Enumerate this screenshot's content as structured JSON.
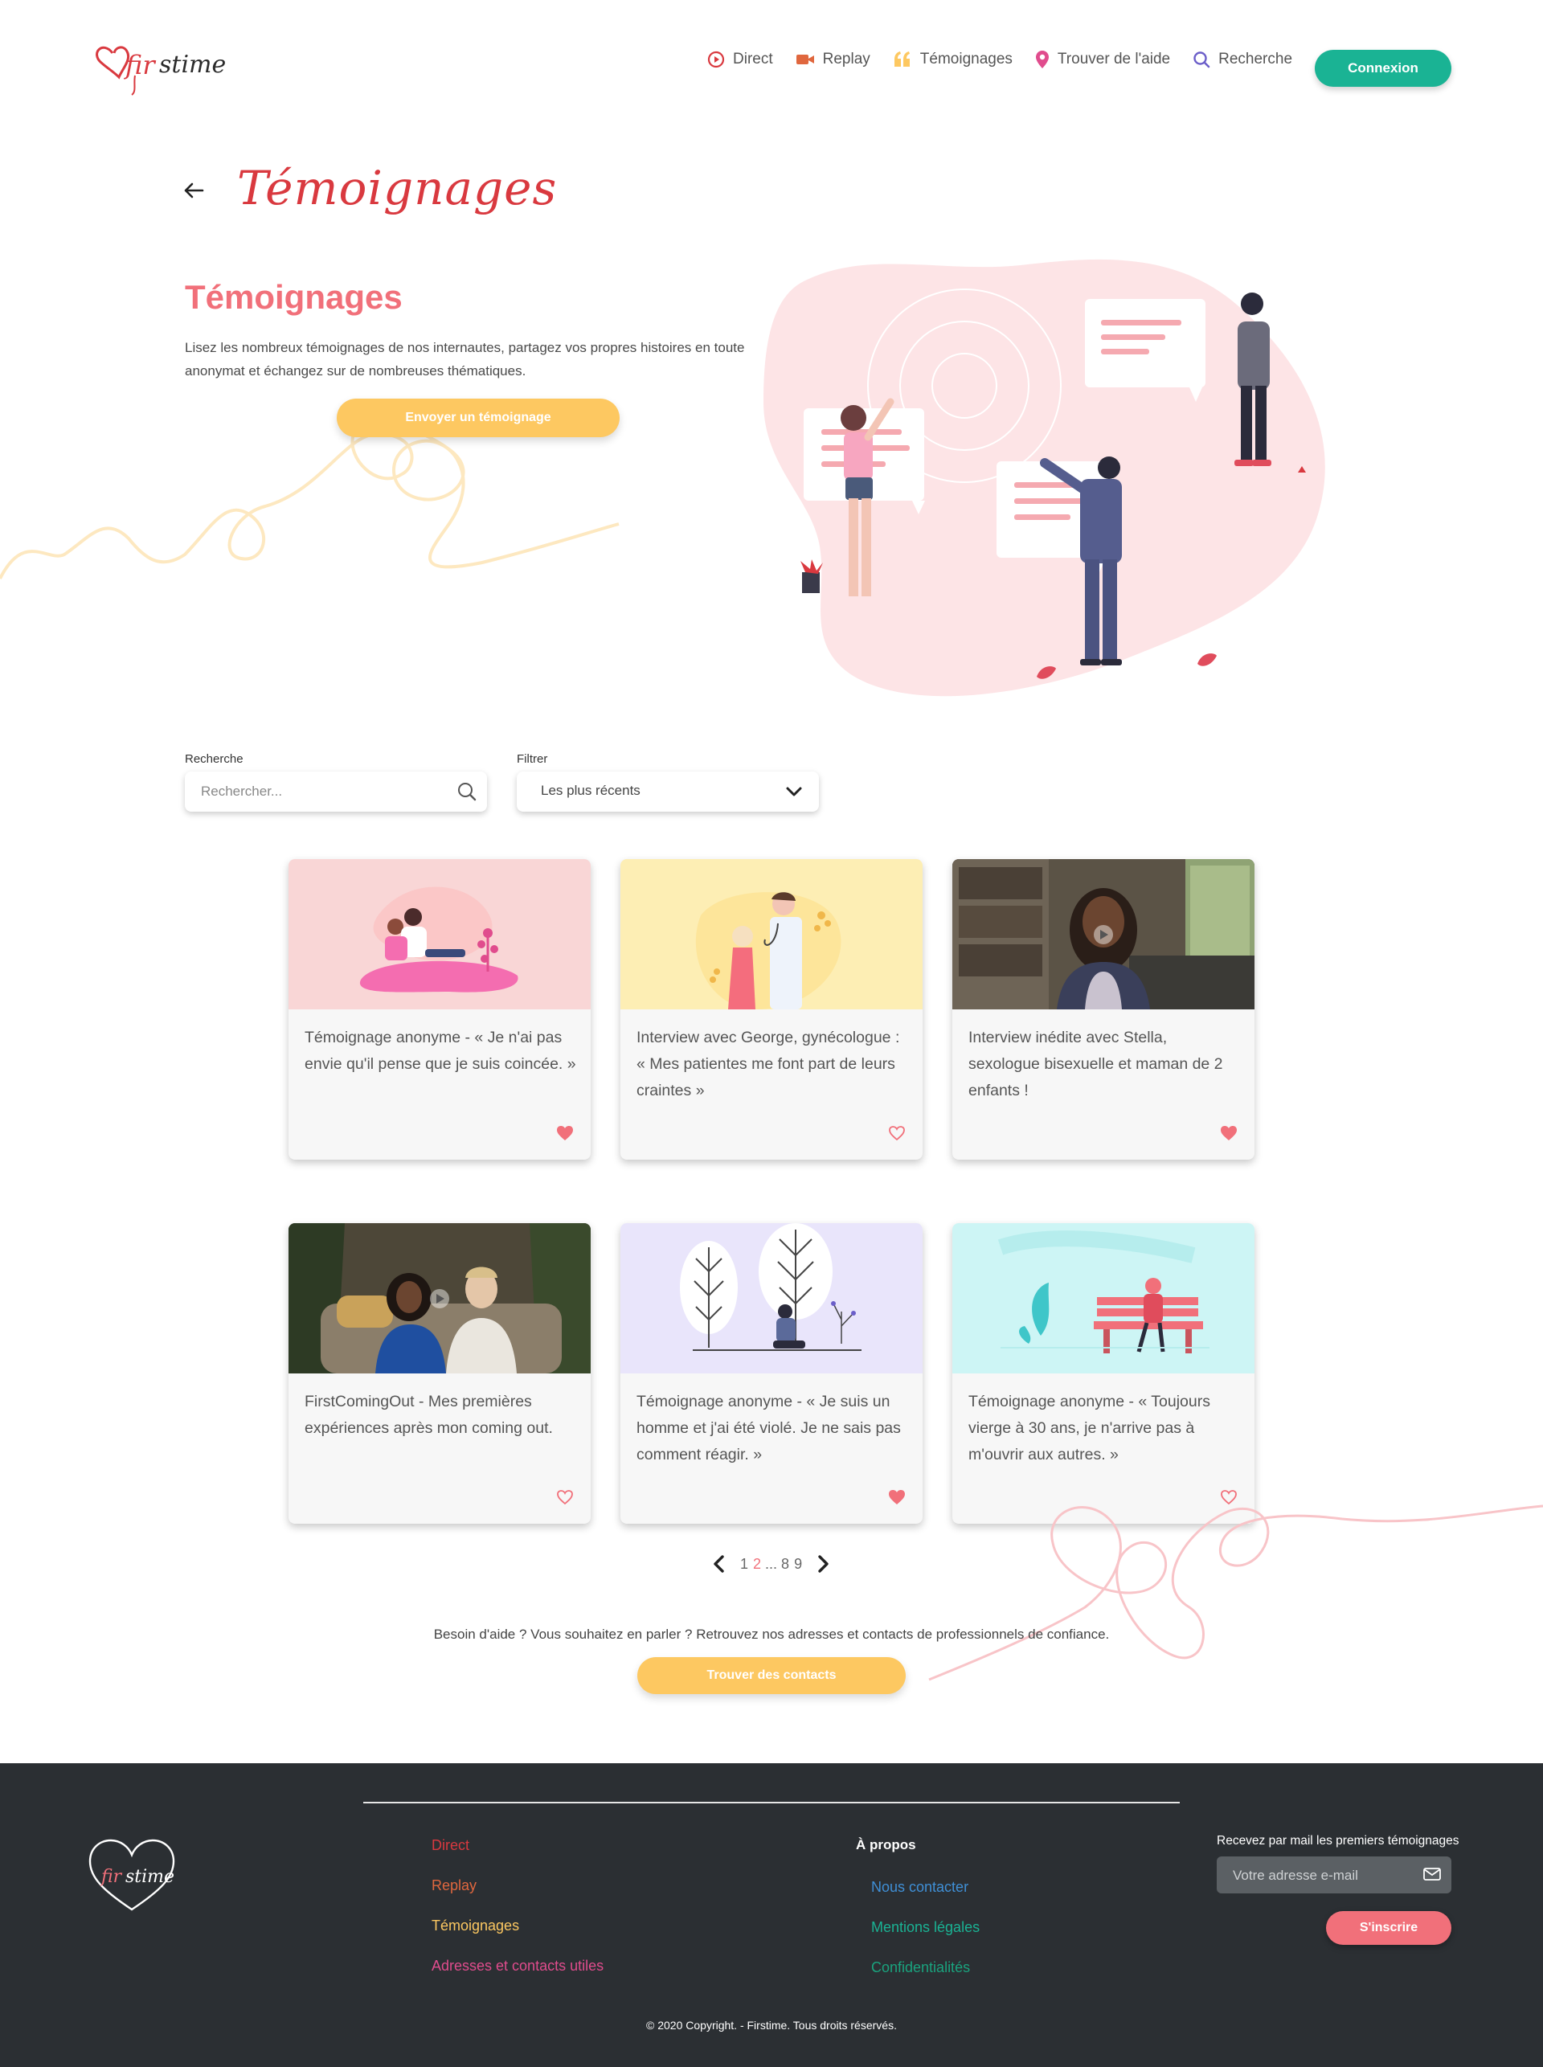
{
  "header": {
    "nav": [
      {
        "label": "Direct",
        "icon": "play-circle-icon",
        "color": "#d9393f"
      },
      {
        "label": "Replay",
        "icon": "video-camera-icon",
        "color": "#e0673e"
      },
      {
        "label": "Témoignages",
        "icon": "quote-icon",
        "color": "#fdc861"
      },
      {
        "label": "Trouver de l'aide",
        "icon": "map-pin-icon",
        "color": "#e04c8d"
      },
      {
        "label": "Recherche",
        "icon": "search-icon",
        "color": "#6b5ec9"
      }
    ],
    "login_label": "Connexion"
  },
  "page_title": "Témoignages",
  "hero": {
    "title": "Témoignages",
    "description": "Lisez les nombreux témoignages de nos internautes, partagez vos propres histoires en toute anonymat et échangez sur de nombreuses thématiques.",
    "button_label": "Envoyer un témoignage"
  },
  "filters": {
    "search_label": "Recherche",
    "search_placeholder": "Rechercher...",
    "filter_label": "Filtrer",
    "filter_value": "Les plus récents"
  },
  "cards": [
    {
      "text": "Témoignage anonyme - « Je n'ai pas envie qu'il pense que je suis coincée. »",
      "liked": true,
      "thumb": "illustration-couple-pink"
    },
    {
      "text": "Interview avec George, gynécologue : « Mes patientes me font part de leurs craintes »",
      "liked": false,
      "thumb": "illustration-doctor-yellow"
    },
    {
      "text": "Interview inédite avec Stella, sexologue bisexuelle et maman de 2 enfants !",
      "liked": true,
      "thumb": "video-stella"
    },
    {
      "text": "FirstComingOut - Mes premières expériences après mon coming out.",
      "liked": false,
      "thumb": "video-comingout"
    },
    {
      "text": "Témoignage anonyme - « Je suis un homme et j'ai été violé. Je ne sais pas comment réagir. »",
      "liked": true,
      "thumb": "illustration-trees-lavender"
    },
    {
      "text": "Témoignage anonyme - « Toujours vierge à 30 ans, je n'arrive pas à m'ouvrir aux autres. »",
      "liked": false,
      "thumb": "illustration-bench-cyan"
    }
  ],
  "pagination": {
    "pages": [
      "1",
      "2",
      "8",
      "9"
    ],
    "current": "2",
    "ellipsis": "..."
  },
  "help": {
    "text": "Besoin d'aide ? Vous souhaitez en parler ? Retrouvez nos adresses et contacts de professionnels de confiance.",
    "button_label": "Trouver des contacts"
  },
  "footer": {
    "links": [
      {
        "label": "Direct",
        "color": "#d9393f"
      },
      {
        "label": "Replay",
        "color": "#e0673e"
      },
      {
        "label": "Témoignages",
        "color": "#fdc861"
      },
      {
        "label": "Adresses et contacts utiles",
        "color": "#e04c8d"
      }
    ],
    "about_title": "À propos",
    "about_links": [
      {
        "label": "Nous contacter",
        "color": "#3f8fd6"
      },
      {
        "label": "Mentions légales",
        "color": "#1ab394"
      },
      {
        "label": "Confidentialités",
        "color": "#1aa37e"
      }
    ],
    "newsletter_label": "Recevez par mail les premiers témoignages",
    "email_placeholder": "Votre adresse e-mail",
    "subscribe_label": "S'inscrire",
    "copyright": "© 2020 Copyright. - Firstime. Tous droits réservés."
  },
  "colors": {
    "brand_red": "#d9393f",
    "coral": "#f1707a",
    "yellow": "#fdc861",
    "green": "#1ab394",
    "footer_bg": "#2b2f33"
  }
}
